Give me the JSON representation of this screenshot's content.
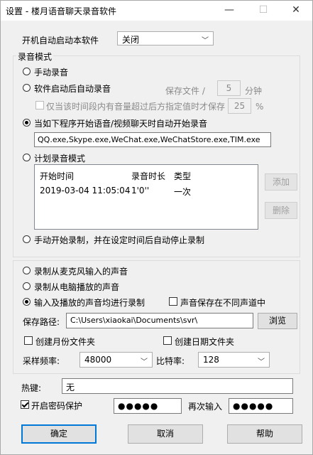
{
  "window": {
    "title": "设置 - 楼月语音聊天录音软件",
    "minimize_glyph": "—",
    "maximize_glyph": "☐",
    "close_glyph": "✕"
  },
  "autostart": {
    "label": "开机自动启动本软件",
    "value": "关闭"
  },
  "record_mode": {
    "group_label": "录音模式",
    "manual": "手动录音",
    "auto_on_start": "软件启动后自动录音",
    "save_file_label": "保存文件 /",
    "save_interval": "5",
    "save_unit": "分钟",
    "threshold_label": "仅当该时间段内有音量超过后方指定值时才保存",
    "threshold_value": "25",
    "threshold_unit": "%",
    "program_trigger": "当如下程序开始语音/视频聊天时自动开始录音",
    "program_list": "QQ.exe,Skype.exe,WeChat.exe,WeChatStore.exe,TIM.exe",
    "schedule": "计划录音模式",
    "table": {
      "headers": [
        "开始时间",
        "录音时长",
        "类型"
      ],
      "rows": [
        [
          "2019-03-04 11:05:04",
          "1'0''",
          "一次"
        ]
      ]
    },
    "add_button": "添加",
    "delete_button": "删除",
    "manual_timed": "手动开始录制，并在设定时间后自动停止录制"
  },
  "source": {
    "mic": "录制从麦克风输入的声音",
    "speaker": "录制从电脑播放的声音",
    "both": "输入及播放的声音均进行录制",
    "separate_channels": "声音保存在不同声道中",
    "path_label": "保存路径:",
    "path_value": "C:\\Users\\xiaokai\\Documents\\svr\\",
    "browse_button": "浏览",
    "month_folder": "创建月份文件夹",
    "date_folder": "创建日期文件夹",
    "sample_rate_label": "采样频率:",
    "sample_rate": "48000",
    "bitrate_label": "比特率:",
    "bitrate": "128"
  },
  "hotkey": {
    "label": "热键:",
    "value": "无"
  },
  "password": {
    "enable_label": "开启密码保护",
    "value": "●●●●●",
    "confirm_label": "再次输入",
    "confirm_value": "●●●●●"
  },
  "buttons": {
    "ok": "确定",
    "cancel": "取消",
    "help": "帮助"
  }
}
